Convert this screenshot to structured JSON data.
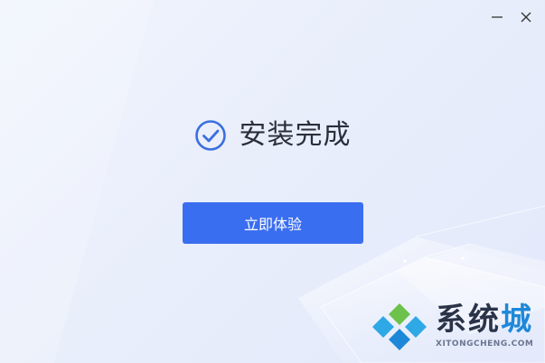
{
  "window": {
    "minimize_icon": "minimize-icon",
    "close_icon": "close-icon"
  },
  "status": {
    "icon": "check-circle-icon",
    "title": "安装完成"
  },
  "primary_action": {
    "label": "立即体验",
    "color": "#3a6ef0"
  },
  "watermark": {
    "brand_main": "系统",
    "brand_accent": "城",
    "subtitle": "XITONGCHENG.COM"
  },
  "colors": {
    "accent": "#3a6ef0",
    "check_icon": "#3b6fe0",
    "title_text": "#2b2f3a"
  }
}
